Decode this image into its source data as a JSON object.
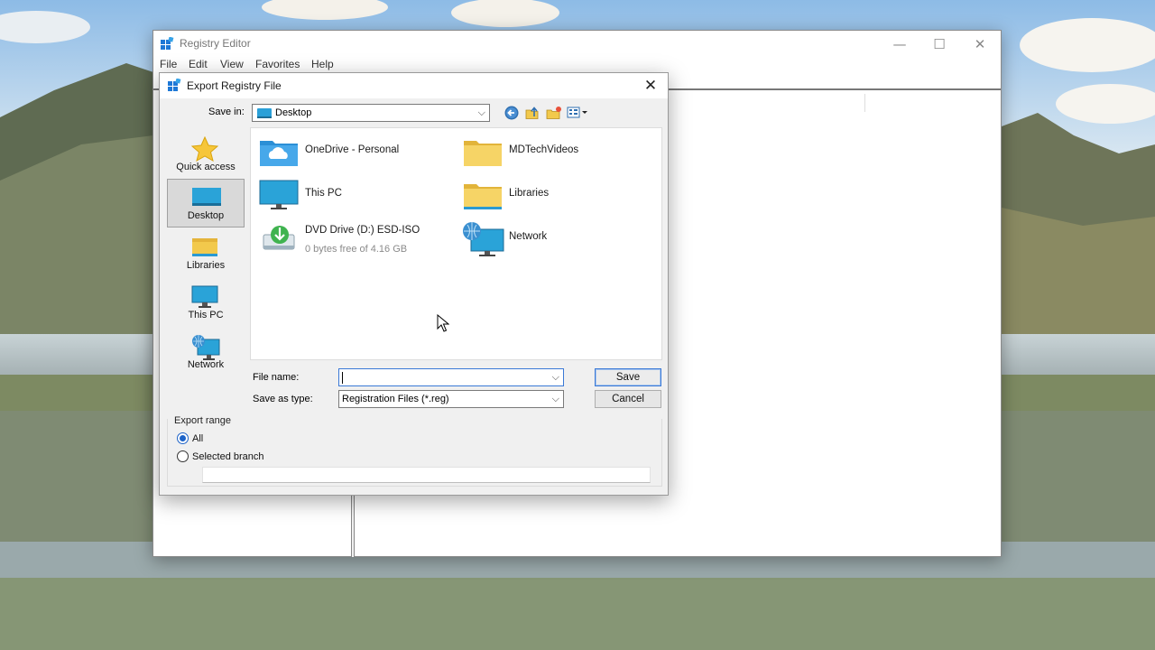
{
  "registry_editor": {
    "title": "Registry Editor",
    "menu": [
      "File",
      "Edit",
      "View",
      "Favorites",
      "Help"
    ],
    "controls": {
      "minimize": "—",
      "maximize": "☐",
      "close": "✕"
    }
  },
  "dialog": {
    "title": "Export Registry File",
    "close_glyph": "✕",
    "save_in": {
      "label": "Save in:",
      "value": "Desktop"
    },
    "toolbar_icons": [
      "back-icon",
      "up-folder-icon",
      "new-folder-icon",
      "view-menu-icon"
    ],
    "places": [
      {
        "label": "Quick access",
        "icon": "star-icon",
        "selected": false
      },
      {
        "label": "Desktop",
        "icon": "desktop-icon",
        "selected": true
      },
      {
        "label": "Libraries",
        "icon": "libraries-icon",
        "selected": false
      },
      {
        "label": "This PC",
        "icon": "pc-icon",
        "selected": false
      },
      {
        "label": "Network",
        "icon": "network-icon",
        "selected": false
      }
    ],
    "files": [
      {
        "name": "OneDrive - Personal",
        "icon": "onedrive-folder-icon"
      },
      {
        "name": "MDTechVideos",
        "icon": "folder-icon"
      },
      {
        "name": "This PC",
        "icon": "pc-icon"
      },
      {
        "name": "Libraries",
        "icon": "libraries-icon"
      },
      {
        "name": "DVD Drive (D:) ESD-ISO",
        "sub": "0 bytes free of 4.16 GB",
        "icon": "dvd-drive-icon"
      },
      {
        "name": "Network",
        "icon": "network-icon"
      }
    ],
    "file_name": {
      "label": "File name:",
      "value": ""
    },
    "save_as_type": {
      "label": "Save as type:",
      "value": "Registration Files (*.reg)"
    },
    "buttons": {
      "save": "Save",
      "cancel": "Cancel"
    },
    "export_range": {
      "legend": "Export range",
      "options": [
        {
          "label": "All",
          "checked": true
        },
        {
          "label": "Selected branch",
          "checked": false
        }
      ],
      "branch_value": ""
    }
  }
}
